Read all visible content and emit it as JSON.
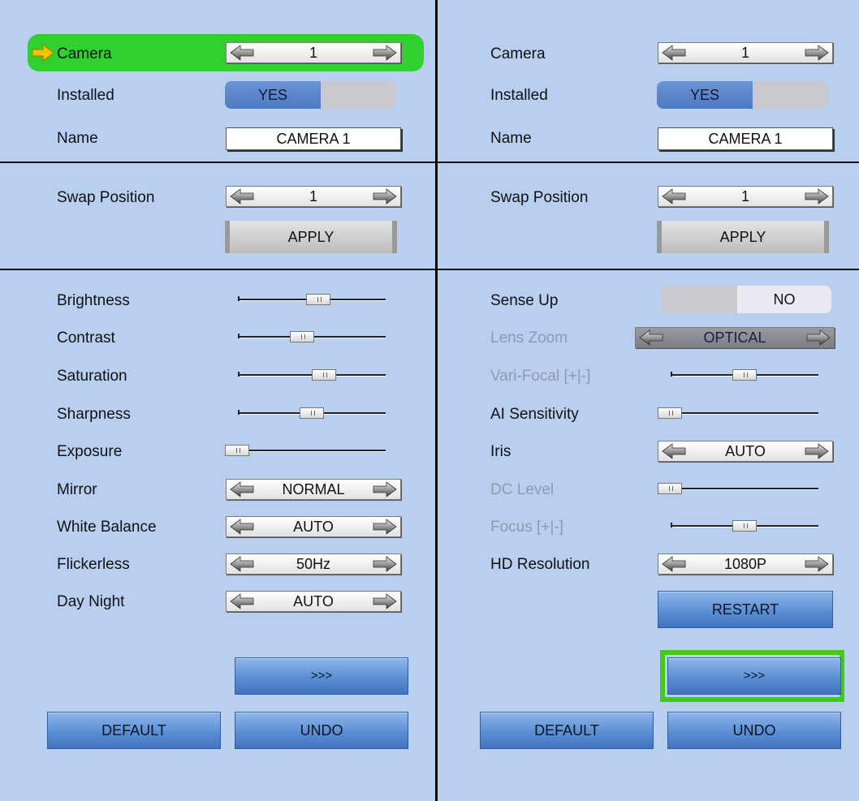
{
  "left": {
    "camera": {
      "label": "Camera",
      "value": "1"
    },
    "installed": {
      "label": "Installed",
      "on": "YES"
    },
    "name": {
      "label": "Name",
      "value": "CAMERA 1"
    },
    "swap": {
      "label": "Swap Position",
      "value": "1",
      "apply": "APPLY"
    },
    "brightness": {
      "label": "Brightness",
      "level": 0.55
    },
    "contrast": {
      "label": "Contrast",
      "level": 0.42
    },
    "saturation": {
      "label": "Saturation",
      "level": 0.6
    },
    "sharpness": {
      "label": "Sharpness",
      "level": 0.5
    },
    "exposure": {
      "label": "Exposure",
      "level": 0.0
    },
    "mirror": {
      "label": "Mirror",
      "value": "NORMAL"
    },
    "white_balance": {
      "label": "White Balance",
      "value": "AUTO"
    },
    "flickerless": {
      "label": "Flickerless",
      "value": "50Hz"
    },
    "day_night": {
      "label": "Day Night",
      "value": "AUTO"
    },
    "next": ">>>",
    "default": "DEFAULT",
    "undo": "UNDO"
  },
  "right": {
    "camera": {
      "label": "Camera",
      "value": "1"
    },
    "installed": {
      "label": "Installed",
      "on": "YES"
    },
    "name": {
      "label": "Name",
      "value": "CAMERA 1"
    },
    "swap": {
      "label": "Swap Position",
      "value": "1",
      "apply": "APPLY"
    },
    "sense_up": {
      "label": "Sense Up",
      "value": "NO"
    },
    "lens_zoom": {
      "label": "Lens Zoom",
      "value": "OPTICAL"
    },
    "vari_focal": {
      "label": "Vari-Focal [+|-]",
      "level": 0.5
    },
    "ai_sensitivity": {
      "label": "AI Sensitivity",
      "level": 0.0
    },
    "iris": {
      "label": "Iris",
      "value": "AUTO"
    },
    "dc_level": {
      "label": "DC Level",
      "level": 0.0
    },
    "focus": {
      "label": "Focus [+|-]",
      "level": 0.5
    },
    "hd_resolution": {
      "label": "HD Resolution",
      "value": "1080P"
    },
    "restart": "RESTART",
    "next": ">>>",
    "default": "DEFAULT",
    "undo": "UNDO"
  },
  "colors": {
    "highlight": "#2fd030",
    "focus_frame": "#43c917",
    "toggle_on": "#5a86cc",
    "background": "#b9cff0"
  }
}
